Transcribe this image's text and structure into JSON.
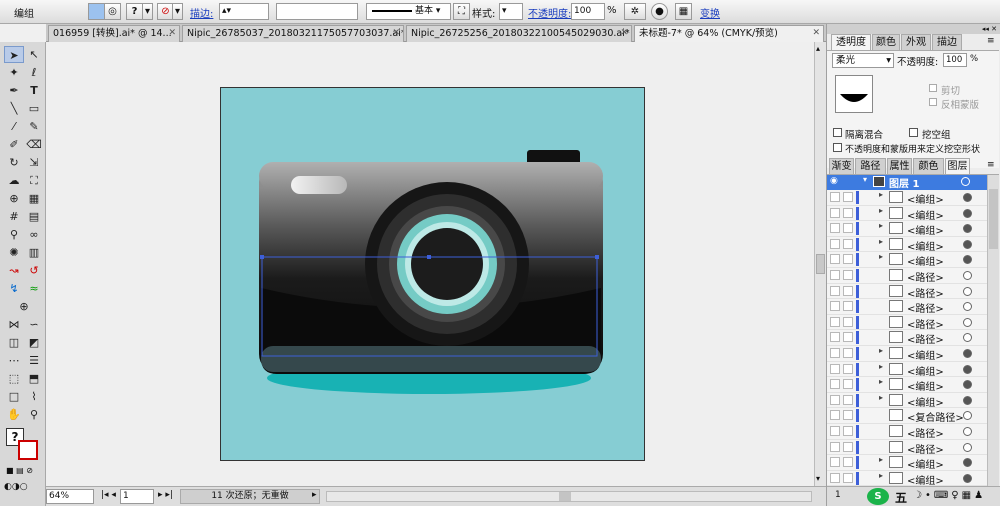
{
  "control_bar": {
    "selection_label": "编组",
    "stroke_label": "描边:",
    "brush_label": "基本",
    "style_label": "样式:",
    "opacity_label": "不透明度:",
    "opacity_value": "100",
    "opacity_unit": "%",
    "transform_label": "变换"
  },
  "doc_tabs": [
    {
      "label": "016959 [转换].ai* @ 14..."
    },
    {
      "label": "Nipic_26785037_20180321175057703037.ai*"
    },
    {
      "label": "Nipic_26725256_20180322100545029030.ai*"
    },
    {
      "label": "未标题-7* @ 64% (CMYK/预览)"
    }
  ],
  "status_bar": {
    "zoom": "64%",
    "page": "1",
    "history": "11 次还原；无重做"
  },
  "transparency_panel": {
    "tabs": [
      "透明度",
      "颜色",
      "外观",
      "描边"
    ],
    "blend_mode": "柔光",
    "opacity_label": "不透明度:",
    "opacity_value": "100",
    "opacity_unit": "%",
    "clip_label": "剪切",
    "invert_mask_label": "反相蒙版",
    "isolate_blending_label": "隔离混合",
    "knockout_group_label": "挖空组",
    "opacity_mask_label": "不透明度和蒙版用来定义挖空形状"
  },
  "layers_panel": {
    "tabs": [
      "渐变",
      "路径查",
      "属性",
      "颜色参",
      "图层"
    ],
    "top_layer": "图层 1",
    "rows": [
      {
        "name": "<编组>",
        "filled": true
      },
      {
        "name": "<编组>",
        "filled": true
      },
      {
        "name": "<编组>",
        "filled": true
      },
      {
        "name": "<编组>",
        "filled": true
      },
      {
        "name": "<编组>",
        "filled": true
      },
      {
        "name": "<路径>",
        "filled": false
      },
      {
        "name": "<路径>",
        "filled": false
      },
      {
        "name": "<路径>",
        "filled": false
      },
      {
        "name": "<路径>",
        "filled": false
      },
      {
        "name": "<路径>",
        "filled": false
      },
      {
        "name": "<编组>",
        "filled": true
      },
      {
        "name": "<编组>",
        "filled": true
      },
      {
        "name": "<编组>",
        "filled": true
      },
      {
        "name": "<编组>",
        "filled": true
      },
      {
        "name": "<复合路径>",
        "filled": false
      },
      {
        "name": "<路径>",
        "filled": false
      },
      {
        "name": "<路径>",
        "filled": false
      },
      {
        "name": "<编组>",
        "filled": true
      },
      {
        "name": "<编组>",
        "filled": true
      }
    ],
    "footer_count": "1"
  },
  "watermark": {
    "text": "五"
  },
  "colors": {
    "artboard": "#86cdd3",
    "shadow": "#18b2b4",
    "lens_ring": "#75cbc5",
    "selection": "#3d5fd8"
  }
}
